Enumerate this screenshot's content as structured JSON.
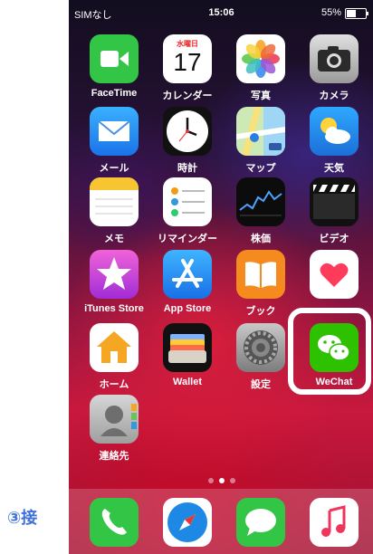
{
  "status_bar": {
    "carrier": "SIMなし",
    "time": "15:06",
    "battery": "55%",
    "battery_level": 0.55
  },
  "calendar_icon": {
    "weekday": "水曜日",
    "day": "17"
  },
  "apps": [
    {
      "name": "facetime",
      "label": "FaceTime"
    },
    {
      "name": "calendar",
      "label": "カレンダー"
    },
    {
      "name": "photos",
      "label": "写真"
    },
    {
      "name": "camera",
      "label": "カメラ"
    },
    {
      "name": "mail",
      "label": "メール"
    },
    {
      "name": "clock",
      "label": "時計"
    },
    {
      "name": "maps",
      "label": "マップ"
    },
    {
      "name": "weather",
      "label": "天気"
    },
    {
      "name": "notes",
      "label": "メモ"
    },
    {
      "name": "reminders",
      "label": "リマインダー"
    },
    {
      "name": "stocks",
      "label": "株価"
    },
    {
      "name": "videos",
      "label": "ビデオ"
    },
    {
      "name": "itunes-store",
      "label": "iTunes Store"
    },
    {
      "name": "app-store",
      "label": "App Store"
    },
    {
      "name": "books",
      "label": "ブック"
    },
    {
      "name": "health",
      "label": ""
    },
    {
      "name": "home",
      "label": "ホーム"
    },
    {
      "name": "wallet",
      "label": "Wallet"
    },
    {
      "name": "settings",
      "label": "設定"
    },
    {
      "name": "wechat",
      "label": "WeChat"
    },
    {
      "name": "contacts",
      "label": "連絡先"
    }
  ],
  "dock": [
    "phone",
    "safari",
    "messages",
    "music"
  ],
  "page_dots": {
    "count": 3,
    "active": 1
  },
  "caption": "③接"
}
